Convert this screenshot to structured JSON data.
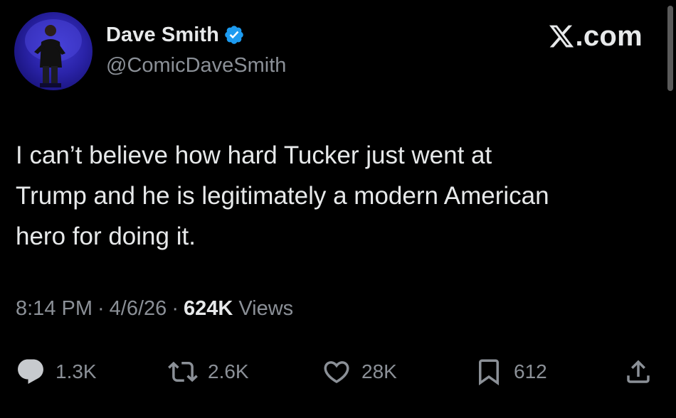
{
  "author": {
    "name": "Dave Smith",
    "handle": "@ComicDaveSmith",
    "verified": true
  },
  "source": {
    "label": "X.com",
    "logo_icon": "x-logo-icon"
  },
  "tweet": {
    "text_lines": [
      "I can’t believe how hard Tucker just went at",
      "Trump and he is legitimately a modern American",
      "hero for doing it."
    ]
  },
  "meta": {
    "time": "8:14 PM",
    "separator": "·",
    "date": "4/6/26",
    "views_count": "624K",
    "views_label": "Views"
  },
  "actions": {
    "replies": "1.3K",
    "reposts": "2.6K",
    "likes": "28K",
    "bookmarks": "612"
  },
  "colors": {
    "background": "#000000",
    "text_primary": "#e7e9ea",
    "text_secondary": "#8b9097",
    "verified_blue": "#1d9bf0"
  }
}
